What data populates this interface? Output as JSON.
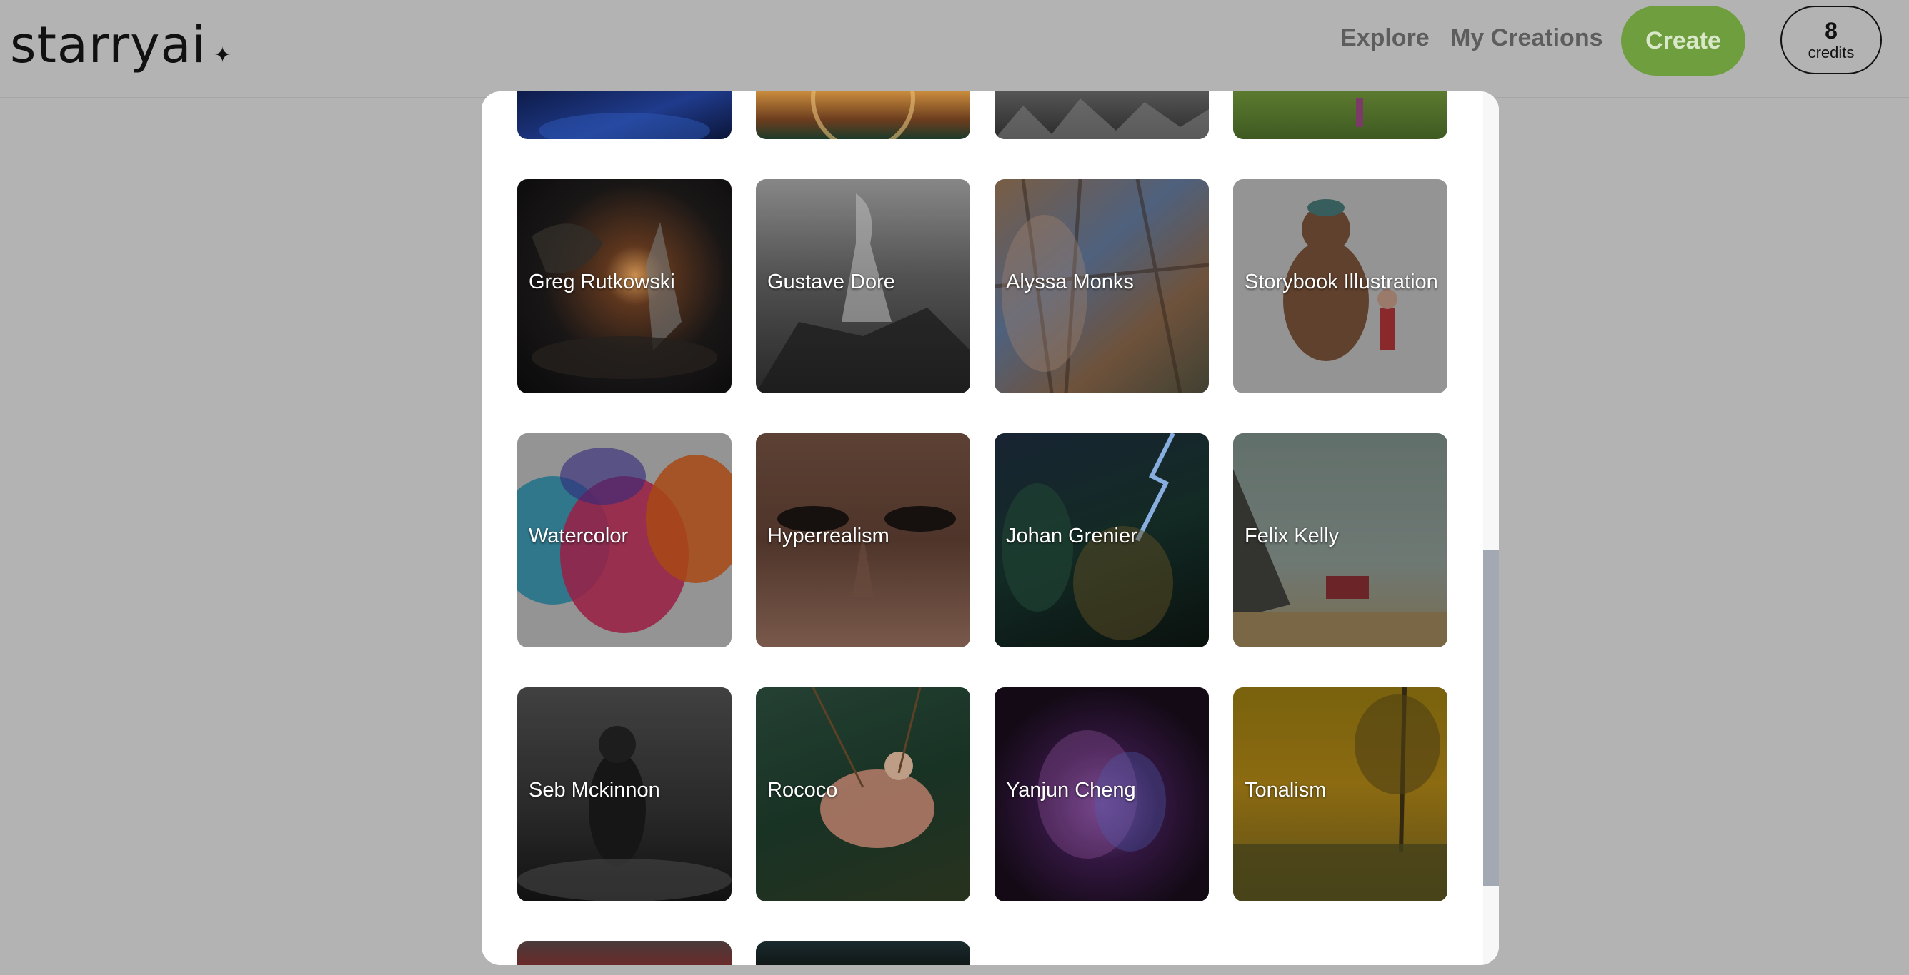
{
  "header": {
    "logo_text": "starryai",
    "logo_star": "✦",
    "nav": [
      {
        "label": "Explore"
      },
      {
        "label": "My Creations"
      }
    ],
    "create_label": "Create",
    "credits_count": "8",
    "credits_label": "credits"
  },
  "styles_grid": {
    "rows": [
      [
        {
          "label": "Greg Rutkowski"
        },
        {
          "label": "Gustave Dore"
        },
        {
          "label": "Alyssa Monks"
        },
        {
          "label": "Storybook Illustration"
        }
      ],
      [
        {
          "label": "Watercolor"
        },
        {
          "label": "Hyperrealism"
        },
        {
          "label": "Johan Grenier"
        },
        {
          "label": "Felix Kelly"
        }
      ],
      [
        {
          "label": "Seb Mckinnon"
        },
        {
          "label": "Rococo"
        },
        {
          "label": "Yanjun Cheng"
        },
        {
          "label": "Tonalism"
        }
      ]
    ]
  },
  "colors": {
    "page_dim": "#b3b3b3",
    "create_button": "#6f9e3e",
    "scroll_thumb": "#a3a9b3"
  }
}
